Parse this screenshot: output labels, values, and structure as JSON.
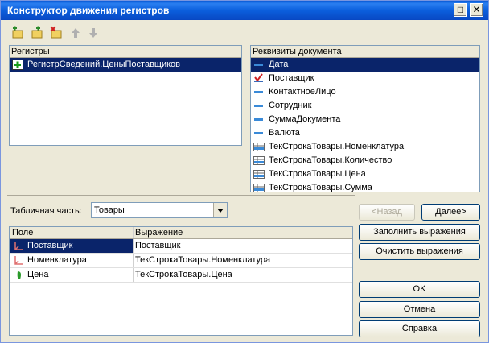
{
  "window": {
    "title": "Конструктор движения регистров"
  },
  "registers": {
    "header": "Регистры",
    "items": [
      {
        "label": "РегистрСведений.ЦеныПоставщиков",
        "icon": "register-add-icon"
      }
    ]
  },
  "requisites": {
    "header": "Реквизиты документа",
    "items": [
      {
        "label": "Дата",
        "icon": "field-icon"
      },
      {
        "label": "Поставщик",
        "icon": "reference-icon"
      },
      {
        "label": "КонтактноеЛицо",
        "icon": "field-icon"
      },
      {
        "label": "Сотрудник",
        "icon": "field-icon"
      },
      {
        "label": "СуммаДокумента",
        "icon": "field-icon"
      },
      {
        "label": "Валюта",
        "icon": "field-icon"
      },
      {
        "label": "ТекСтрокаТовары.Номенклатура",
        "icon": "table-field-icon"
      },
      {
        "label": "ТекСтрокаТовары.Количество",
        "icon": "table-field-icon"
      },
      {
        "label": "ТекСтрокаТовары.Цена",
        "icon": "table-field-icon"
      },
      {
        "label": "ТекСтрокаТовары.Сумма",
        "icon": "table-field-icon"
      }
    ]
  },
  "tabular": {
    "label": "Табличная часть:",
    "value": "Товары"
  },
  "grid": {
    "col1": "Поле",
    "col2": "Выражение",
    "rows": [
      {
        "field": "Поставщик",
        "expr": "Поставщик",
        "icon": "dimension-icon"
      },
      {
        "field": "Номенклатура",
        "expr": "ТекСтрокаТовары.Номенклатура",
        "icon": "dimension-icon"
      },
      {
        "field": "Цена",
        "expr": "ТекСтрокаТовары.Цена",
        "icon": "resource-icon"
      }
    ]
  },
  "buttons": {
    "back": "<Назад",
    "next": "Далее>",
    "fill": "Заполнить выражения",
    "clear": "Очистить выражения",
    "ok": "OK",
    "cancel": "Отмена",
    "help": "Справка"
  }
}
